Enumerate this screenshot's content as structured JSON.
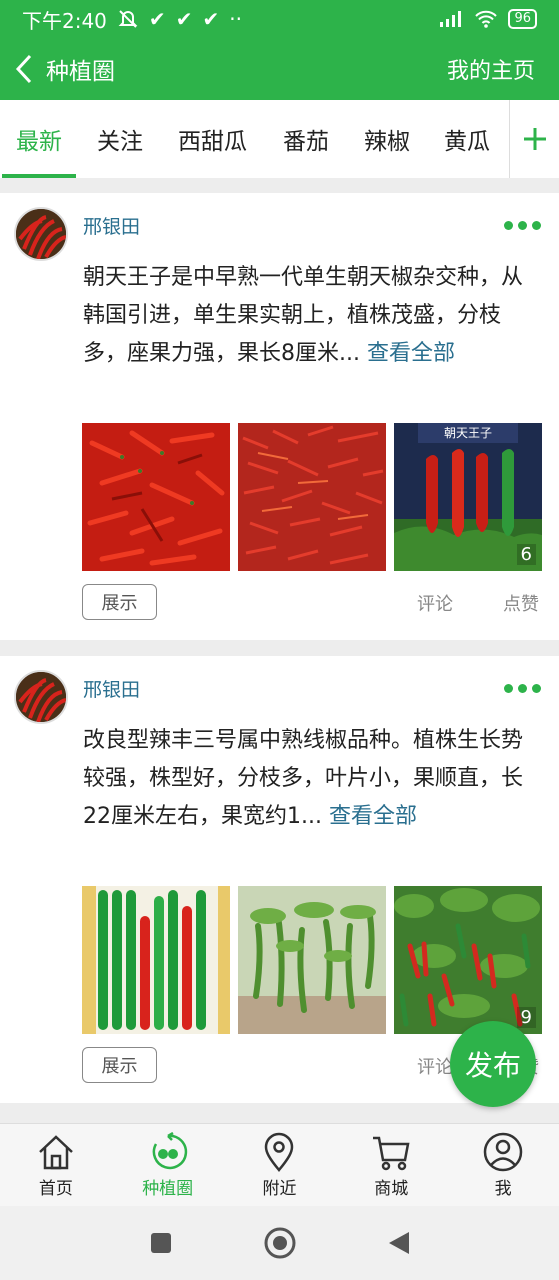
{
  "status": {
    "time": "下午2:40",
    "battery": "96"
  },
  "header": {
    "title": "种植圈",
    "my_home": "我的主页"
  },
  "tabs": [
    {
      "label": "最新",
      "active": true
    },
    {
      "label": "关注",
      "active": false
    },
    {
      "label": "西甜瓜",
      "active": false
    },
    {
      "label": "番茄",
      "active": false
    },
    {
      "label": "辣椒",
      "active": false
    },
    {
      "label": "黄瓜",
      "active": false
    }
  ],
  "posts": [
    {
      "username": "邢银田",
      "text": "朝天王子是中早熟一代单生朝天椒杂交种，从韩国引进，单生果实朝上，植株茂盛，分枝多，座果力强，果长8厘米...",
      "expand": "查看全部",
      "photo_count": "6",
      "photo3_caption": "朝天王子",
      "show_label": "展示",
      "comment_label": "评论",
      "like_label": "点赞"
    },
    {
      "username": "邢银田",
      "text": "改良型辣丰三号属中熟线椒品种。植株生长势较强，株型好，分枝多，叶片小，果顺直，长22厘米左右，果宽约1...",
      "expand": "查看全部",
      "photo_count": "9",
      "show_label": "展示",
      "comment_label": "评论",
      "like_label": "点赞"
    }
  ],
  "fab": {
    "label": "发布"
  },
  "bottom_nav": [
    {
      "label": "首页",
      "icon": "home-icon"
    },
    {
      "label": "种植圈",
      "icon": "circle-icon",
      "active": true
    },
    {
      "label": "附近",
      "icon": "location-icon"
    },
    {
      "label": "商城",
      "icon": "cart-icon"
    },
    {
      "label": "我",
      "icon": "user-icon"
    }
  ],
  "colors": {
    "brand": "#2db34a",
    "link": "#2a6f8f"
  }
}
